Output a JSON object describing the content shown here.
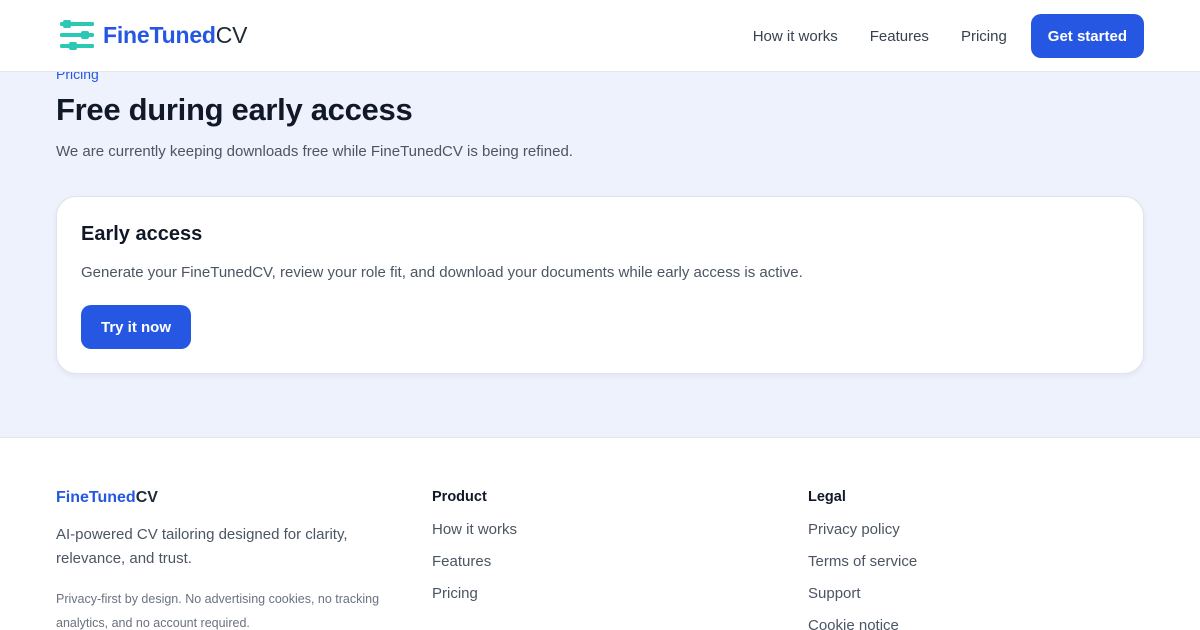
{
  "header": {
    "brand": {
      "part1": "FineTuned",
      "part2": "CV"
    },
    "logo_icon": "sliders-icon",
    "nav": [
      "How it works",
      "Features",
      "Pricing"
    ],
    "cta_label": "Get started"
  },
  "hero": {
    "eyebrow": "Pricing",
    "title": "Free during early access",
    "subtitle": "We are currently keeping downloads free while FineTunedCV is being refined."
  },
  "card": {
    "title": "Early access",
    "text": "Generate your FineTunedCV, review your role fit, and download your documents while early access is active.",
    "button_label": "Try it now"
  },
  "footer": {
    "brand": {
      "part1": "FineTuned",
      "part2": "CV"
    },
    "tagline": "AI-powered CV tailoring designed for clarity, relevance, and trust.",
    "note": "Privacy-first by design. No advertising cookies, no tracking analytics, and no account required.",
    "product": {
      "heading": "Product",
      "links": [
        "How it works",
        "Features",
        "Pricing"
      ]
    },
    "legal": {
      "heading": "Legal",
      "links": [
        "Privacy policy",
        "Terms of service",
        "Support",
        "Cookie notice"
      ]
    }
  },
  "colors": {
    "accent": "#2557e3",
    "logo_teal": "#2bc9b4",
    "hero_bg": "#eef2fd"
  }
}
